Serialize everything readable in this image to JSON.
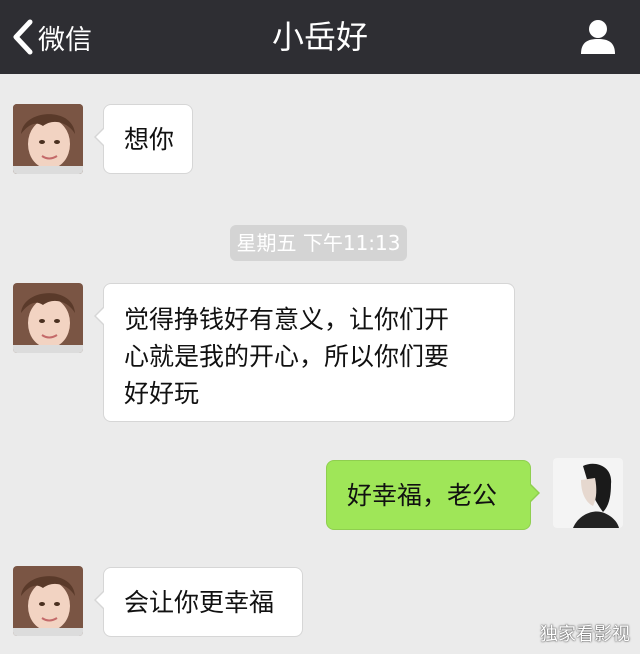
{
  "nav": {
    "back_label": "微信",
    "title": "小岳好",
    "back_icon": "chevron-left-icon",
    "profile_icon": "person-icon"
  },
  "colors": {
    "navbar": "#2e2e33",
    "chat_background": "#ebebeb",
    "incoming_bubble": "#ffffff",
    "outgoing_bubble": "#9fe658",
    "timestamp_chip": "#d4d4d4"
  },
  "messages": [
    {
      "side": "left",
      "text": "想你",
      "avatar": "girl-avatar"
    },
    {
      "type": "timestamp",
      "text": "星期五 下午11:13"
    },
    {
      "side": "left",
      "lines": [
        "觉得挣钱好有意义，让你们开",
        "心就是我的开心，所以你们要",
        "好好玩"
      ],
      "avatar": "girl-avatar"
    },
    {
      "side": "right",
      "text": "好幸福，老公",
      "avatar": "woman-avatar"
    },
    {
      "side": "left",
      "text": "会让你更幸福",
      "avatar": "girl-avatar"
    }
  ],
  "watermark": "独家看影视"
}
